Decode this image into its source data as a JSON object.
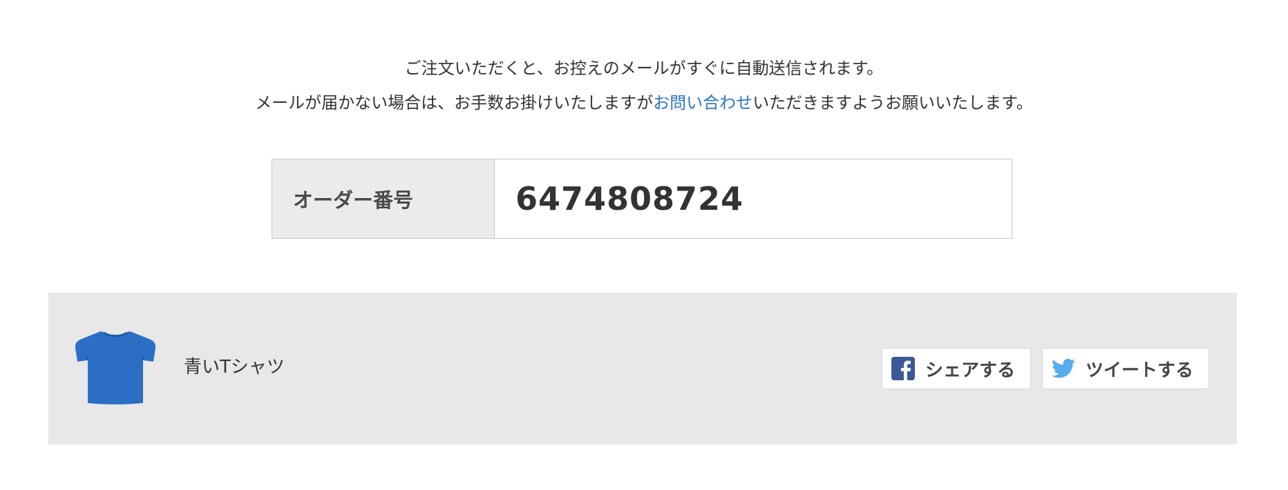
{
  "notice": {
    "line1": "ご注文いただくと、お控えのメールがすぐに自動送信されます。",
    "line2_before": "メールが届かない場合は、お手数お掛けいたしますが",
    "line2_link": "お問い合わせ",
    "line2_after": "いただきますようお願いいたします。"
  },
  "order": {
    "label": "オーダー番号",
    "number": "6474808724"
  },
  "product": {
    "name": "青いTシャツ",
    "image_icon": "blue-tshirt-icon"
  },
  "share": {
    "facebook_label": "シェアする",
    "facebook_icon": "facebook-icon",
    "twitter_label": "ツイートする",
    "twitter_icon": "twitter-icon"
  },
  "colors": {
    "link": "#2b77c8",
    "product_bar_bg": "#e8e8e8",
    "order_label_bg": "#ebebeb",
    "facebook": "#3b5998",
    "twitter": "#55acee",
    "tshirt": "#2a6fc4"
  }
}
